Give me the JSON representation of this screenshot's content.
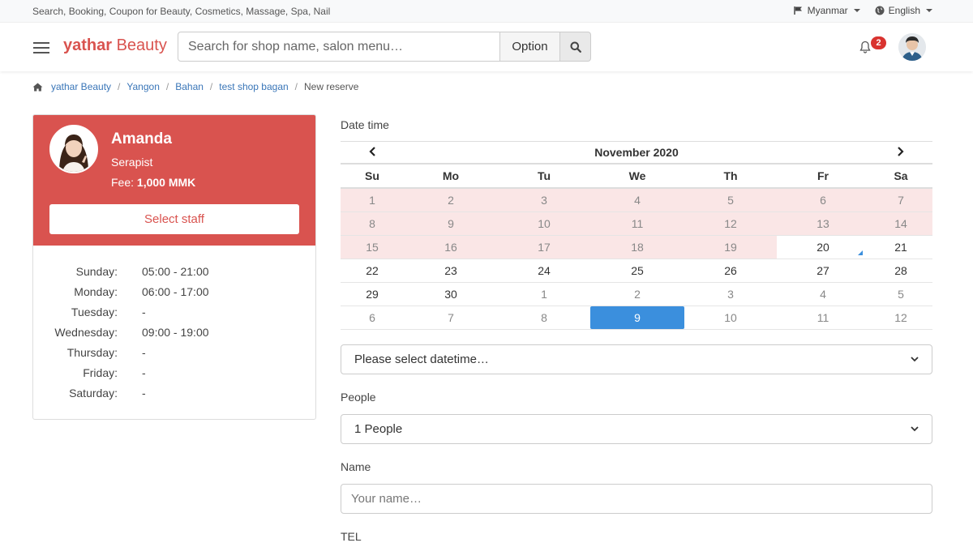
{
  "topbar": {
    "tagline": "Search, Booking, Coupon for Beauty, Cosmetics, Massage, Spa, Nail",
    "region": "Myanmar",
    "language": "English"
  },
  "header": {
    "logo_bold": "yathar",
    "logo_rest": " Beauty",
    "search_placeholder": "Search for shop name, salon menu…",
    "option_label": "Option",
    "notification_count": "2"
  },
  "breadcrumb": {
    "items": [
      "yathar Beauty",
      "Yangon",
      "Bahan",
      "test shop bagan"
    ],
    "current": "New reserve"
  },
  "staff": {
    "name": "Amanda",
    "role": "Serapist",
    "fee_label": "Fee: ",
    "fee_value": "1,000 MMK",
    "select_label": "Select staff",
    "hours": [
      {
        "day": "Sunday:",
        "time": "05:00 - 21:00"
      },
      {
        "day": "Monday:",
        "time": "06:00 - 17:00"
      },
      {
        "day": "Tuesday:",
        "time": "-"
      },
      {
        "day": "Wednesday:",
        "time": "09:00 - 19:00"
      },
      {
        "day": "Thursday:",
        "time": "-"
      },
      {
        "day": "Friday:",
        "time": "-"
      },
      {
        "day": "Saturday:",
        "time": "-"
      }
    ]
  },
  "form": {
    "datetime_label": "Date time",
    "calendar": {
      "month_title": "November 2020",
      "weekdays": [
        "Su",
        "Mo",
        "Tu",
        "We",
        "Th",
        "Fr",
        "Sa"
      ],
      "weeks": [
        [
          "1",
          "2",
          "3",
          "4",
          "5",
          "6",
          "7"
        ],
        [
          "8",
          "9",
          "10",
          "11",
          "12",
          "13",
          "14"
        ],
        [
          "15",
          "16",
          "17",
          "18",
          "19",
          "20",
          "21"
        ],
        [
          "22",
          "23",
          "24",
          "25",
          "26",
          "27",
          "28"
        ],
        [
          "29",
          "30",
          "1",
          "2",
          "3",
          "4",
          "5"
        ],
        [
          "6",
          "7",
          "8",
          "9",
          "10",
          "11",
          "12"
        ]
      ],
      "selected": "9"
    },
    "datetime_select": "Please select datetime…",
    "people_label": "People",
    "people_select": "1 People",
    "name_label": "Name",
    "name_placeholder": "Your name…",
    "tel_label": "TEL"
  },
  "colors": {
    "brand": "#d9534f",
    "link": "#3a76b8",
    "selected": "#3b8fdd",
    "past_day": "#fae6e6"
  }
}
